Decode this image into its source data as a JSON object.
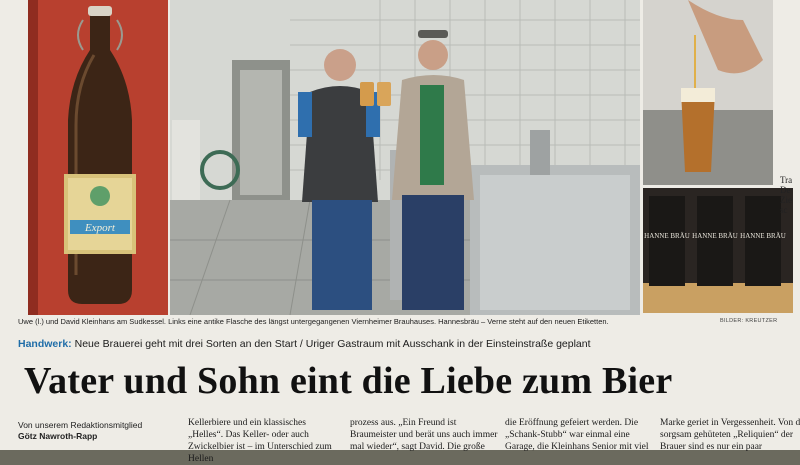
{
  "caption": "Uwe (l.) und David Kleinhans am Sudkessel. Links eine antike Flasche des längst untergegangenen Viernheimer Brauhauses. Hannesbräu – Verne steht auf den neuen Etiketten.",
  "photo_credit": "BILDER: KREUTZER",
  "kicker": {
    "lead": "Handwerk:",
    "text": " Neue Brauerei geht mit drei Sorten an den Start / Uriger Gastraum mit Ausschank in der Einsteinstraße geplant"
  },
  "headline": "Vater und Sohn eint die Liebe zum Bier",
  "byline": {
    "line": "Von unserem Redaktionsmitglied",
    "author": "Götz Nawroth-Rapp"
  },
  "columns": [
    "Kellerbiere und ein klassisches „Helles“. Das Keller- oder auch Zwickelbier ist – im Unterschied zum Hellen",
    "prozess aus. „Ein Freund ist Braumeister und berät uns auch immer mal wieder“, sagt David. Die große",
    "die Eröffnung gefeiert werden. Die „Schank-Stubb“ war einmal eine Garage, die Kleinhans Senior mit viel",
    "Marke geriet in Vergessenheit. Von den sorgsam gehüteten „Reliquien“ der Brauer sind es nur ein paar"
  ],
  "bottle_label": "Export",
  "label_text": "HANNE BRÄU",
  "side_text": "Tra\nDe\nZie\nsc"
}
